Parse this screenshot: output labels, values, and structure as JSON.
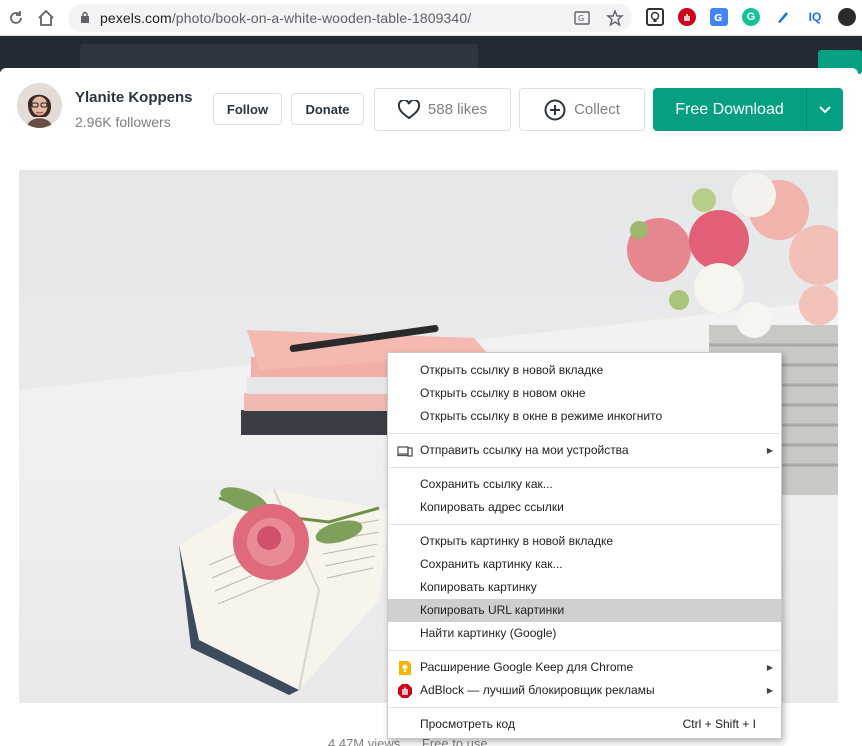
{
  "browser": {
    "url_domain": "pexels.com",
    "url_path": "/photo/book-on-a-white-wooden-table-1809340/",
    "extensions": [
      {
        "name": "keep-extension-icon",
        "label": ""
      },
      {
        "name": "adblock-extension-icon",
        "label": ""
      },
      {
        "name": "translate-extension-icon",
        "label": ""
      },
      {
        "name": "grammarly-extension-icon",
        "label": "G"
      },
      {
        "name": "pen-extension-icon",
        "label": ""
      },
      {
        "name": "iq-extension-icon",
        "label": "IQ"
      },
      {
        "name": "ninja-extension-icon",
        "label": ""
      }
    ]
  },
  "author": {
    "name": "Ylanite Koppens",
    "followers": "2.96K followers"
  },
  "actions": {
    "follow_label": "Follow",
    "donate_label": "Donate",
    "likes_label": "588 likes",
    "collect_label": "Collect",
    "download_label": "Free Download"
  },
  "stats": {
    "views": "4.47M views",
    "license": "Free to use"
  },
  "context_menu": {
    "open_link_new_tab": "Открыть ссылку в новой вкладке",
    "open_link_new_window": "Открыть ссылку в новом окне",
    "open_link_incognito": "Открыть ссылку в окне в режиме инкогнито",
    "send_link_devices": "Отправить ссылку на мои устройства",
    "save_link_as": "Сохранить ссылку как...",
    "copy_link_address": "Копировать адрес ссылки",
    "open_image_new_tab": "Открыть картинку в новой вкладке",
    "save_image_as": "Сохранить картинку как...",
    "copy_image": "Копировать картинку",
    "copy_image_url": "Копировать URL картинки",
    "search_image_google": "Найти картинку (Google)",
    "google_keep_extension": "Расширение Google Keep для Chrome",
    "adblock": "AdBlock — лучший блокировщик рекламы",
    "inspect": "Просмотреть код",
    "inspect_shortcut": "Ctrl + Shift + I",
    "highlighted_item": "copy_image_url"
  },
  "colors": {
    "accent_green": "#05a081",
    "menu_highlight": "#cfcfcf",
    "header_dark": "#232a34"
  }
}
